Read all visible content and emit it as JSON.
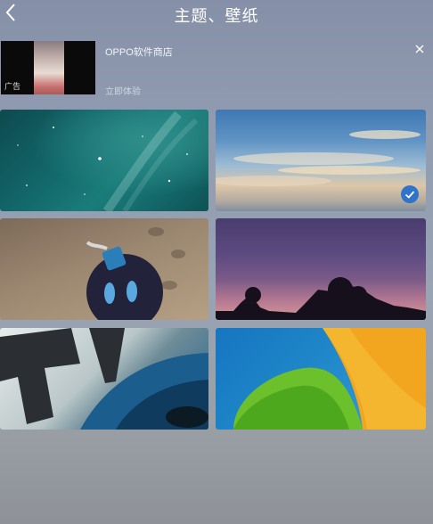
{
  "header": {
    "title": "主题、壁纸",
    "back_icon": "back-chevron-icon"
  },
  "ad": {
    "app_name": "OPPO软件商店",
    "action": "立即体验",
    "badge": "广告",
    "close_icon": "close-icon"
  },
  "wallpapers": [
    {
      "id": "space",
      "selected": false
    },
    {
      "id": "sky",
      "selected": true
    },
    {
      "id": "bomb",
      "selected": false
    },
    {
      "id": "dusk",
      "selected": false
    },
    {
      "id": "car",
      "selected": false
    },
    {
      "id": "paper",
      "selected": false
    }
  ],
  "colors": {
    "selected_check": "#2f74c8"
  }
}
